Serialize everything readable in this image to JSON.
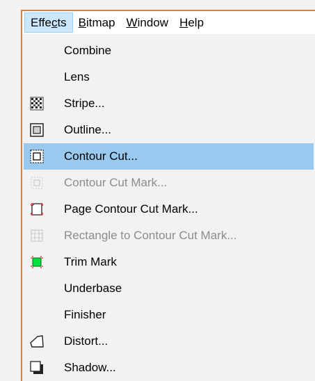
{
  "menubar": {
    "items": [
      {
        "pre": "Effe",
        "ul": "c",
        "post": "ts"
      },
      {
        "pre": "",
        "ul": "B",
        "post": "itmap"
      },
      {
        "pre": "",
        "ul": "W",
        "post": "indow"
      },
      {
        "pre": "",
        "ul": "H",
        "post": "elp"
      }
    ]
  },
  "dropdown": {
    "items": [
      {
        "label": "Combine",
        "icon": "none",
        "state": "enabled"
      },
      {
        "label": "Lens",
        "icon": "none",
        "state": "enabled"
      },
      {
        "label": "Stripe...",
        "icon": "stripe-icon",
        "state": "enabled"
      },
      {
        "label": "Outline...",
        "icon": "outline-icon",
        "state": "enabled"
      },
      {
        "label": "Contour Cut...",
        "icon": "contour-cut-icon",
        "state": "highlighted"
      },
      {
        "label": "Contour Cut Mark...",
        "icon": "contour-cut-mark-icon",
        "state": "disabled"
      },
      {
        "label": "Page Contour Cut Mark...",
        "icon": "page-contour-cut-mark-icon",
        "state": "enabled"
      },
      {
        "label": "Rectangle to Contour Cut Mark...",
        "icon": "rectangle-contour-cut-mark-icon",
        "state": "disabled"
      },
      {
        "label": "Trim Mark",
        "icon": "trim-mark-icon",
        "state": "enabled"
      },
      {
        "label": "Underbase",
        "icon": "none",
        "state": "enabled"
      },
      {
        "label": "Finisher",
        "icon": "none",
        "state": "enabled"
      },
      {
        "label": "Distort...",
        "icon": "distort-icon",
        "state": "enabled"
      },
      {
        "label": "Shadow...",
        "icon": "shadow-icon",
        "state": "enabled"
      }
    ]
  },
  "colors": {
    "frame_border": "#e87d2a",
    "menu_active_bg": "#cce8ff",
    "item_highlight_bg": "#99c9ef",
    "disabled_text": "#8c8c8c",
    "trim_mark_fill": "#00e040",
    "cut_mark_red": "#e03030"
  }
}
